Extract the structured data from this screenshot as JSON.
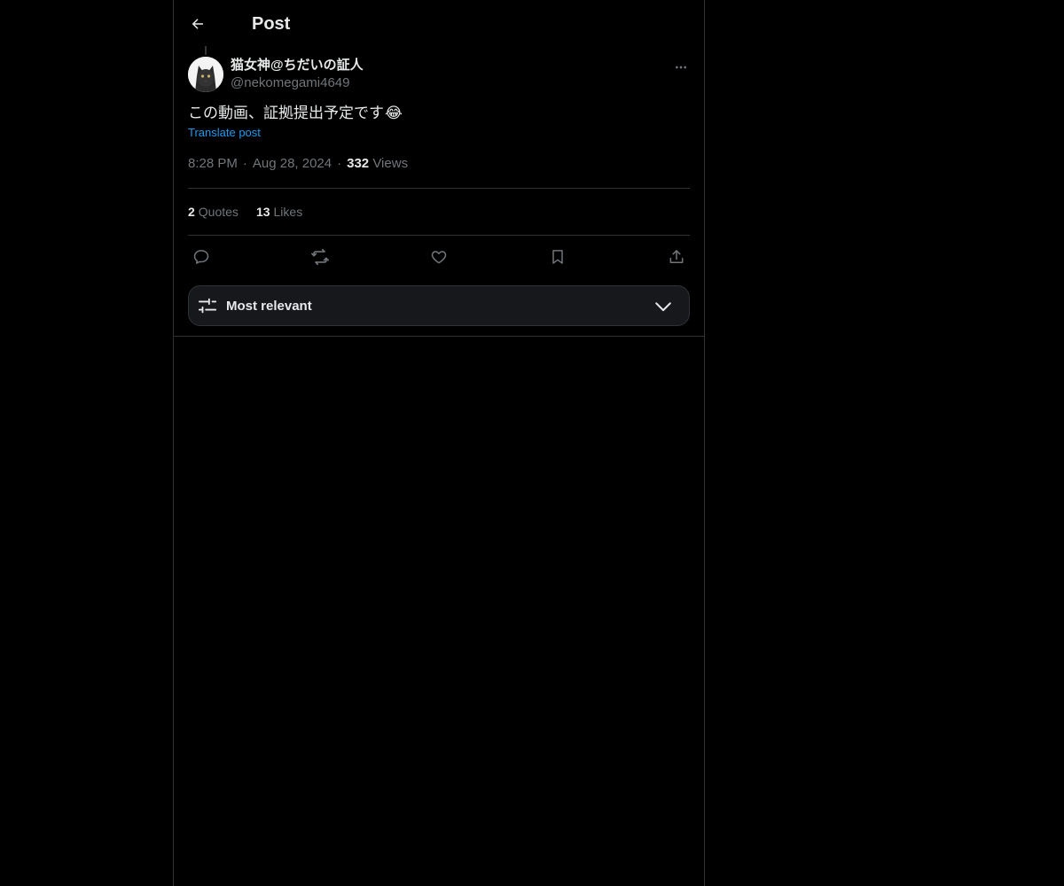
{
  "header": {
    "title": "Post"
  },
  "post": {
    "display_name": "猫女神@ちだいの証人",
    "handle": "@nekomegami4649",
    "text": "この動画、証拠提出予定です",
    "emoji": "😂",
    "translate_label": "Translate post",
    "time": "8:28 PM",
    "date": "Aug 28, 2024",
    "views_count": "332",
    "views_label": "Views",
    "dot": "·"
  },
  "stats": {
    "quotes_count": "2",
    "quotes_label": "Quotes",
    "likes_count": "13",
    "likes_label": "Likes"
  },
  "sort": {
    "label": "Most relevant"
  },
  "colors": {
    "background": "#000000",
    "text": "#e7e9ea",
    "muted": "#71767b",
    "link": "#1d9bf0",
    "border": "#2f3336"
  },
  "icons": [
    "back-arrow-icon",
    "more-icon",
    "reply-icon",
    "repost-icon",
    "like-icon",
    "bookmark-icon",
    "share-icon",
    "filter-icon",
    "chevron-down-icon"
  ]
}
